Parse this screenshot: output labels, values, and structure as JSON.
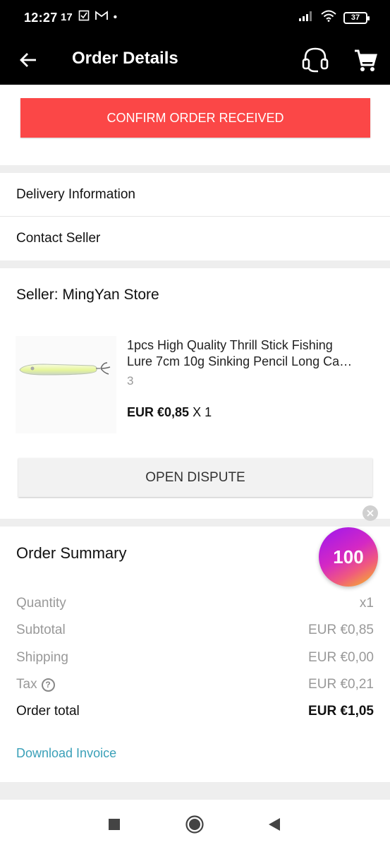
{
  "status_bar": {
    "time": "12:27",
    "left_icons": [
      "17",
      "checkbox-icon",
      "gmail-icon",
      "•"
    ],
    "battery": "37"
  },
  "app_bar": {
    "title": "Order Details",
    "back_icon": "arrow-left-icon",
    "support_icon": "headset-icon",
    "cart_icon": "cart-icon"
  },
  "confirm_button": {
    "label": "CONFIRM ORDER RECEIVED",
    "color": "#fb4747"
  },
  "links": [
    {
      "label": "Delivery Information"
    },
    {
      "label": "Contact Seller"
    }
  ],
  "seller": {
    "name": "Seller: MingYan Store",
    "product": {
      "title_line1": "1pcs High Quality Thrill Stick Fishing",
      "title_line2": "Lure 7cm 10g Sinking Pencil Long Ca…",
      "variant": "3",
      "price": "EUR €0,85",
      "quantity": "X 1"
    },
    "dispute_label": "OPEN DISPUTE"
  },
  "summary": {
    "title": "Order Summary",
    "rows": [
      {
        "label": "Quantity",
        "value": "x1"
      },
      {
        "label": "Subtotal",
        "value": "EUR €0,85"
      },
      {
        "label": "Shipping",
        "value": "EUR €0,00"
      },
      {
        "label": "Tax",
        "value": "EUR €0,21"
      }
    ],
    "total": {
      "label": "Order total",
      "value": "EUR €1,05"
    },
    "invoice_link": "Download Invoice",
    "link_color": "#3aa0b8"
  },
  "coin_badge": {
    "value": "100"
  },
  "system_nav": [
    "square-icon",
    "circle-icon",
    "triangle-back-icon"
  ]
}
